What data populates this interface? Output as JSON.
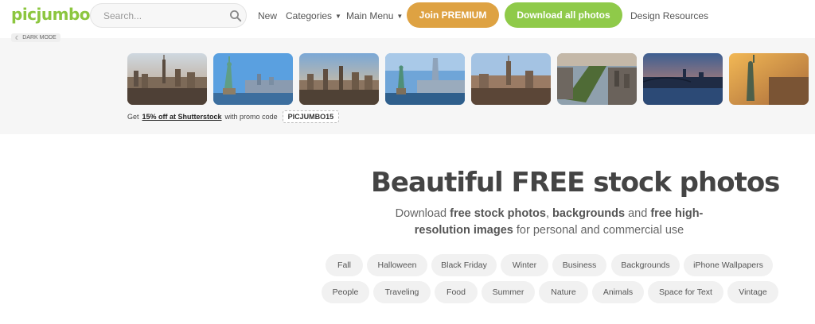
{
  "header": {
    "logo": "picjumbo",
    "search": {
      "placeholder": "Search..."
    },
    "nav": {
      "new": "New",
      "categories": "Categories",
      "main_menu": "Main Menu",
      "design_resources": "Design Resources"
    },
    "buttons": {
      "join_premium": "Join PREMIUM",
      "download_all": "Download all photos"
    },
    "dark_mode": "DARK MODE"
  },
  "promo": {
    "prefix": "Get",
    "link": "15% off at Shutterstock",
    "middle": "with promo code",
    "code": "PICJUMBO15"
  },
  "hero": {
    "title": "Beautiful FREE stock photos",
    "sub": {
      "t1": "Download ",
      "b1": "free stock photos",
      "t2": ", ",
      "b2": "backgrounds",
      "t3": " and ",
      "b3": "free high-resolution images",
      "t4": " for personal and commercial use"
    }
  },
  "tags_row1": [
    "Fall",
    "Halloween",
    "Black Friday",
    "Winter",
    "Business",
    "Backgrounds",
    "iPhone Wallpapers"
  ],
  "tags_row2": [
    "People",
    "Traveling",
    "Food",
    "Summer",
    "Nature",
    "Animals",
    "Space for Text",
    "Vintage"
  ],
  "theme": {
    "green": "#8cc63f",
    "orange": "#dea242",
    "download_green": "#8fca49"
  }
}
